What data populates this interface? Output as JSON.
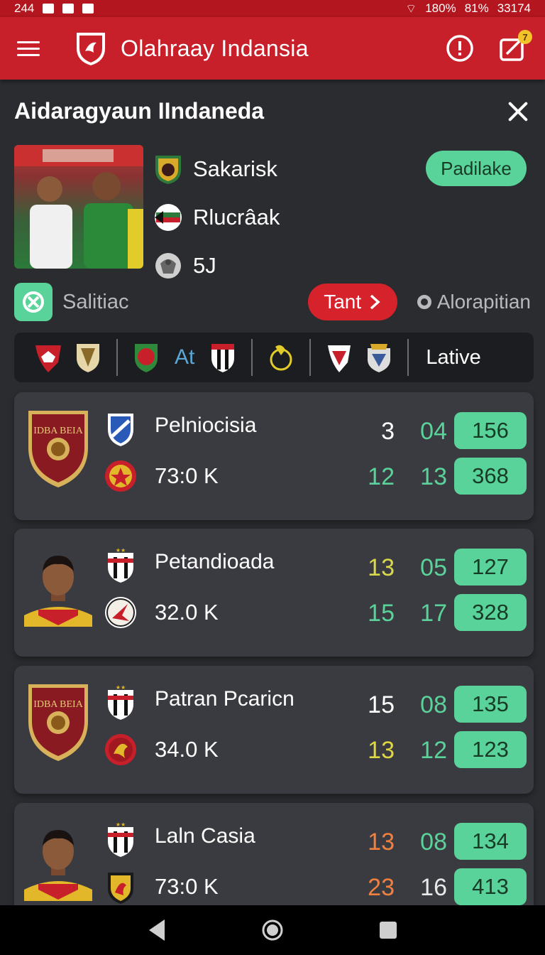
{
  "status_bar": {
    "time": "244",
    "battery1": "180%",
    "battery2": "81%",
    "clock": "33174"
  },
  "app_bar": {
    "title": "Olahraay Indansia",
    "badge_count": "7"
  },
  "page": {
    "title": "Aidaragyaun IIndaneda",
    "meta": [
      {
        "label": "Sakarisk",
        "icon": "team-crest-icon"
      },
      {
        "label": "Rlucrâak",
        "icon": "flag-crest-icon"
      },
      {
        "label": "5J",
        "icon": "eagle-crest-icon"
      }
    ],
    "status_pill": "Padilake",
    "action": {
      "label": "Salitiac",
      "button": "Tant",
      "location": "Alorapitian"
    }
  },
  "filter_bar": {
    "text_item": "At",
    "active": "Lative"
  },
  "players": [
    {
      "name": "Pelniocisia",
      "value": "73:0 K",
      "avatar": "crest",
      "stats_top": [
        "3",
        "04"
      ],
      "stats_bottom": [
        "12",
        "13"
      ],
      "colors_top": [
        "#ffffff",
        "#5ad39a"
      ],
      "colors_bottom": [
        "#5ad39a",
        "#5ad39a"
      ],
      "pill_top": "156",
      "pill_bottom": "368"
    },
    {
      "name": "Petandioada",
      "value": "32.0 K",
      "avatar": "person",
      "stats_top": [
        "13",
        "05"
      ],
      "stats_bottom": [
        "15",
        "17"
      ],
      "colors_top": [
        "#d8d84a",
        "#5ad39a"
      ],
      "colors_bottom": [
        "#5ad39a",
        "#5ad39a"
      ],
      "pill_top": "127",
      "pill_bottom": "328"
    },
    {
      "name": "Patran Pcaricn",
      "value": "34.0 K",
      "avatar": "crest",
      "stats_top": [
        "15",
        "08"
      ],
      "stats_bottom": [
        "13",
        "12"
      ],
      "colors_top": [
        "#ffffff",
        "#5ad39a"
      ],
      "colors_bottom": [
        "#e0d640",
        "#5ad39a"
      ],
      "pill_top": "135",
      "pill_bottom": "123"
    },
    {
      "name": "Laln Casia",
      "value": "73:0 K",
      "avatar": "person",
      "stats_top": [
        "13",
        "08"
      ],
      "stats_bottom": [
        "23",
        "16"
      ],
      "colors_top": [
        "#f08040",
        "#5ad39a"
      ],
      "colors_bottom": [
        "#f08040",
        "#e8e8e8"
      ],
      "pill_top": "134",
      "pill_bottom": "413"
    }
  ],
  "crest_text": "IDBA BEIA",
  "colors": {
    "primary_red": "#c8202a",
    "accent_green": "#5ad39a",
    "background": "#2b2c30",
    "card": "#3a3b40"
  }
}
